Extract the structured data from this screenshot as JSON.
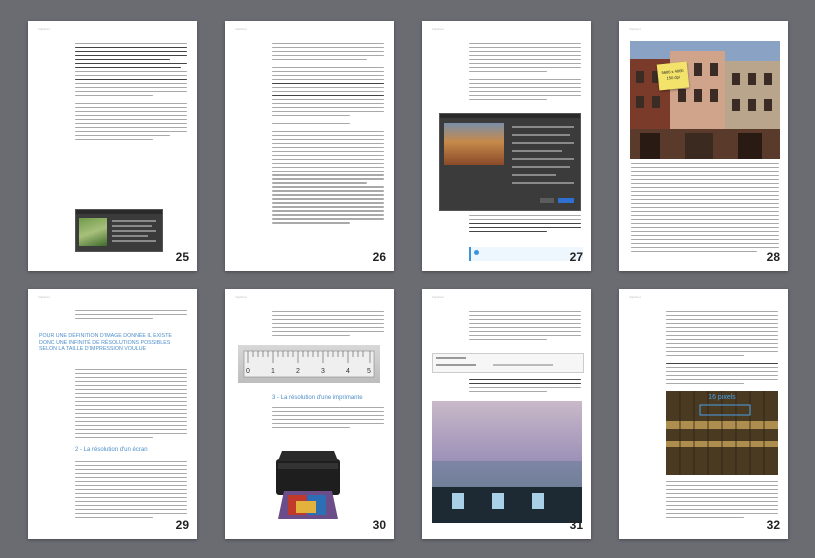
{
  "header": "Imprimer",
  "footer": "",
  "pages": [
    {
      "num": "25"
    },
    {
      "num": "26"
    },
    {
      "num": "27"
    },
    {
      "num": "28",
      "sticky_note": "5600 x 4000\n150 dpi"
    },
    {
      "num": "29",
      "section_title": "POUR UNE DÉFINITION D'IMAGE DONNÉE IL EXISTE DONC UNE INFINITÉ DE RÉSOLUTIONS POSSIBLES SELON LA TAILLE D'IMPRESSION VOULUE",
      "sub_title": "2 - La résolution d'un écran"
    },
    {
      "num": "30",
      "sub_title": "3 - La résolution d'une imprimante",
      "ruler_labels": [
        "0",
        "1",
        "2",
        "3",
        "4",
        "5"
      ]
    },
    {
      "num": "31"
    },
    {
      "num": "32",
      "zoom_label": "16 pixels"
    }
  ]
}
